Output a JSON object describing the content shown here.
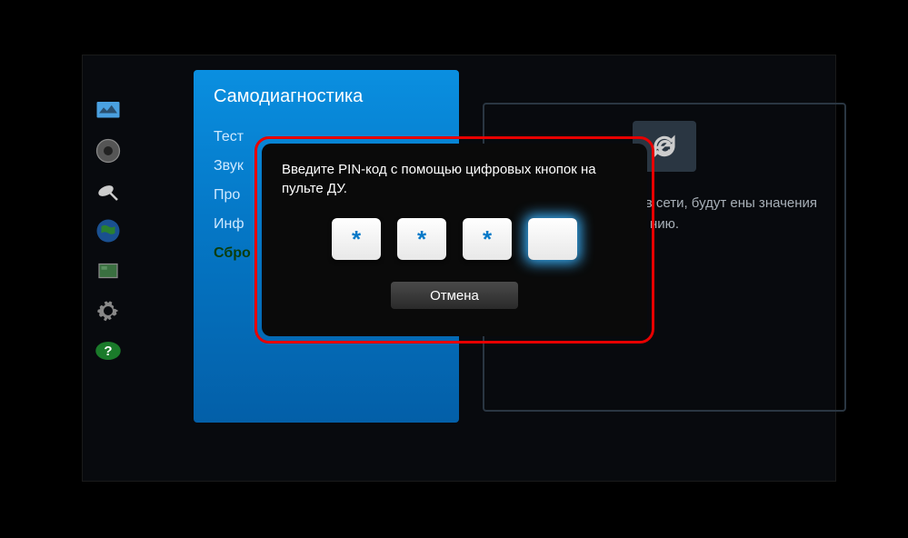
{
  "sidebar": {
    "icons": [
      "picture",
      "sound",
      "satellite",
      "globe",
      "system",
      "gear",
      "help"
    ]
  },
  "panel": {
    "title": "Самодиагностика",
    "items": [
      {
        "label": "Тест",
        "selected": false
      },
      {
        "label": "Звук",
        "selected": false
      },
      {
        "label": "Про",
        "selected": false
      },
      {
        "label": "Инф",
        "selected": false
      },
      {
        "label": "Сбро",
        "selected": true
      }
    ]
  },
  "detail": {
    "text": "параметров, чением в сети, будут ены значения нию."
  },
  "modal": {
    "prompt": "Введите PIN-код с помощью цифровых кнопок на пульте ДУ.",
    "pins": [
      "*",
      "*",
      "*",
      ""
    ],
    "active_index": 3,
    "cancel_label": "Отмена"
  }
}
